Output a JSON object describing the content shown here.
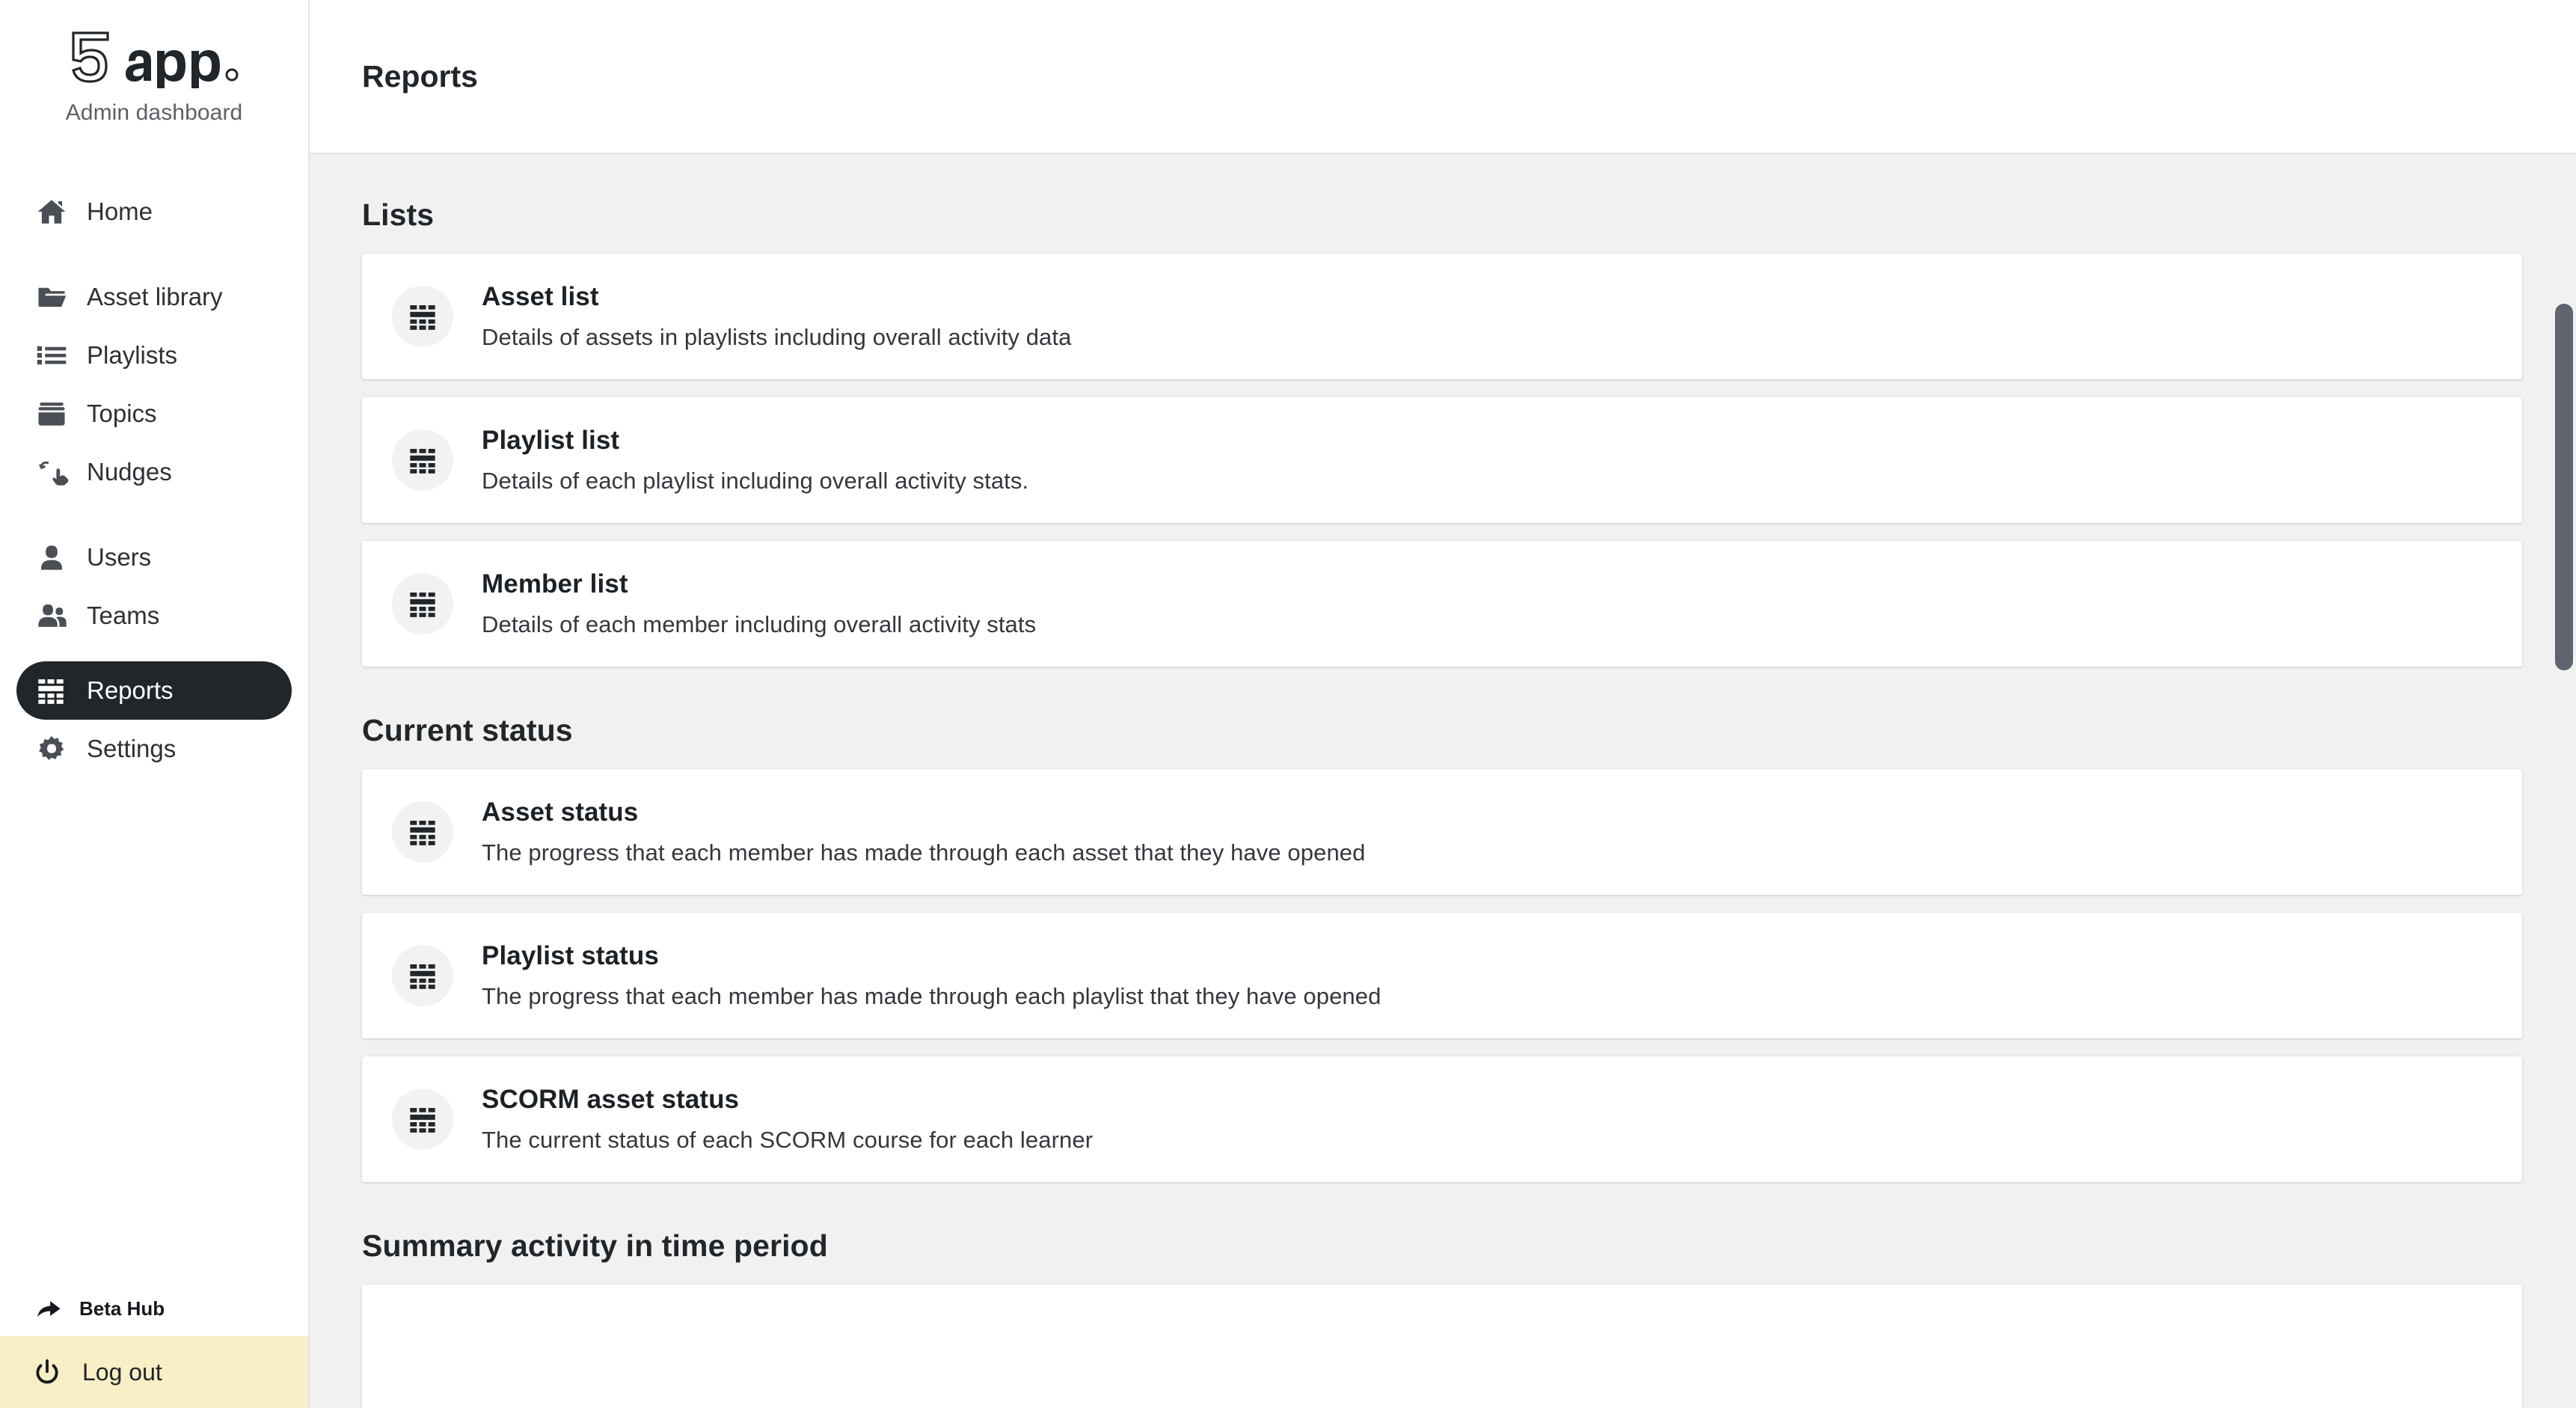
{
  "brand": {
    "logo_text": "5app",
    "subtitle": "Admin dashboard"
  },
  "sidebar": {
    "items": [
      {
        "label": "Home",
        "icon": "home-icon",
        "active": false
      },
      {
        "label": "Asset library",
        "icon": "folder-open-icon",
        "active": false
      },
      {
        "label": "Playlists",
        "icon": "list-icon",
        "active": false
      },
      {
        "label": "Topics",
        "icon": "archive-box-icon",
        "active": false
      },
      {
        "label": "Nudges",
        "icon": "hand-pointer-icon",
        "active": false
      },
      {
        "label": "Users",
        "icon": "user-icon",
        "active": false
      },
      {
        "label": "Teams",
        "icon": "users-icon",
        "active": false
      },
      {
        "label": "Reports",
        "icon": "grid-table-icon",
        "active": true
      },
      {
        "label": "Settings",
        "icon": "gear-icon",
        "active": false
      }
    ],
    "beta_hub": {
      "label": "Beta Hub",
      "icon": "share-arrow-icon"
    },
    "logout": {
      "label": "Log out",
      "icon": "power-icon",
      "background": "#f8efc6"
    }
  },
  "header": {
    "title": "Reports"
  },
  "main": {
    "sections": [
      {
        "heading": "Lists",
        "cards": [
          {
            "icon": "grid-table-icon",
            "title": "Asset list",
            "description": "Details of assets in playlists including overall activity data"
          },
          {
            "icon": "grid-table-icon",
            "title": "Playlist list",
            "description": "Details of each playlist including overall activity stats."
          },
          {
            "icon": "grid-table-icon",
            "title": "Member list",
            "description": "Details of each member including overall activity stats"
          }
        ]
      },
      {
        "heading": "Current status",
        "cards": [
          {
            "icon": "grid-table-icon",
            "title": "Asset status",
            "description": "The progress that each member has made through each asset that they have opened"
          },
          {
            "icon": "grid-table-icon",
            "title": "Playlist status",
            "description": "The progress that each member has made through each playlist that they have opened"
          },
          {
            "icon": "grid-table-icon",
            "title": "SCORM asset status",
            "description": "The current status of each SCORM course for each learner"
          }
        ]
      },
      {
        "heading": "Summary activity in time period",
        "cards": []
      }
    ]
  },
  "colors": {
    "accent_dark": "#21262b",
    "page_background": "#f1f1f1",
    "card_background": "#ffffff",
    "logout_background": "#f8efc6",
    "scrollbar_thumb": "#5e656e"
  }
}
